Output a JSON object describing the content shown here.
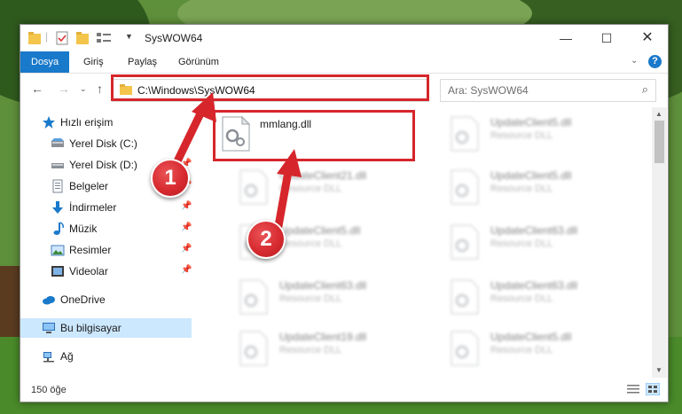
{
  "window": {
    "title": "SysWOW64"
  },
  "ribbon": {
    "tabs": [
      {
        "label": "Dosya",
        "active": true
      },
      {
        "label": "Giriş"
      },
      {
        "label": "Paylaş"
      },
      {
        "label": "Görünüm"
      }
    ]
  },
  "address": {
    "path": "C:\\Windows\\SysWOW64"
  },
  "search": {
    "placeholder": "Ara: SysWOW64"
  },
  "sidebar": {
    "items": [
      {
        "label": "Hızlı erişim",
        "icon": "star-icon"
      },
      {
        "label": "Yerel Disk (C:)",
        "icon": "drive-icon",
        "pinned": true
      },
      {
        "label": "Yerel Disk (D:)",
        "icon": "drive-icon",
        "pinned": true
      },
      {
        "label": "Belgeler",
        "icon": "document-icon",
        "pinned": true
      },
      {
        "label": "İndirmeler",
        "icon": "download-icon",
        "pinned": true
      },
      {
        "label": "Müzik",
        "icon": "music-icon",
        "pinned": true
      },
      {
        "label": "Resimler",
        "icon": "picture-icon",
        "pinned": true
      },
      {
        "label": "Videolar",
        "icon": "video-icon",
        "pinned": true
      },
      {
        "label": "OneDrive",
        "icon": "cloud-icon"
      },
      {
        "label": "Bu bilgisayar",
        "icon": "computer-icon",
        "selected": true
      },
      {
        "label": "Ağ",
        "icon": "network-icon"
      }
    ]
  },
  "files": {
    "highlighted": {
      "name": "mmlang.dll"
    },
    "left_column": [
      {
        "name": "UpdateClient21.dll",
        "type": "Resource DLL"
      },
      {
        "name": "UpdateClient5.dll",
        "type": "Resource DLL"
      },
      {
        "name": "UpdateClient63.dll",
        "type": "Resource DLL"
      },
      {
        "name": "UpdateClient19.dll",
        "type": "Resource DLL"
      }
    ],
    "right_column": [
      {
        "name": "UpdateClient5.dll",
        "type": "Resource DLL"
      },
      {
        "name": "UpdateClient5.dll",
        "type": "Resource DLL"
      },
      {
        "name": "UpdateClient63.dll",
        "type": "Resource DLL"
      },
      {
        "name": "UpdateClient63.dll",
        "type": "Resource DLL"
      },
      {
        "name": "UpdateClient5.dll",
        "type": "Resource DLL"
      }
    ]
  },
  "status": {
    "count": "150 öğe"
  },
  "annotations": {
    "step1": "1",
    "step2": "2",
    "color": "#d6262b"
  },
  "colors": {
    "accent": "#1979ca",
    "selected_bg": "#cce8ff"
  }
}
